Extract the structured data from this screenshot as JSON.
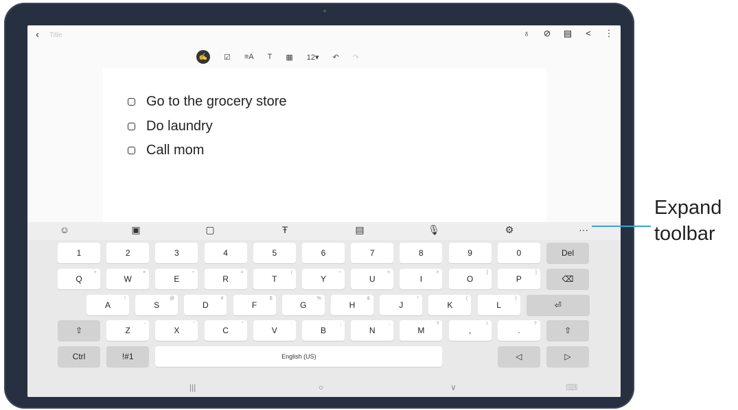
{
  "app": {
    "back_icon": "‹",
    "title_placeholder": "Title"
  },
  "top_icons": [
    {
      "name": "pen-settings-icon",
      "glyph": "♁"
    },
    {
      "name": "attach-icon",
      "glyph": "⊘"
    },
    {
      "name": "reader-icon",
      "glyph": "▤"
    },
    {
      "name": "share-icon",
      "glyph": "<"
    },
    {
      "name": "more-options-icon",
      "glyph": "⋮"
    }
  ],
  "format_toolbar": {
    "pen": "✍",
    "checkbox": "☑",
    "text_style": "≡A",
    "text_format": "T",
    "table": "▦",
    "font_size": "12▾",
    "undo": "↶",
    "redo": "↷"
  },
  "todos": [
    "Go to the grocery store",
    "Do laundry",
    "Call mom"
  ],
  "keyboard_toolbar": [
    {
      "name": "emoji-icon",
      "glyph": "☺"
    },
    {
      "name": "sticker-icon",
      "glyph": "▣"
    },
    {
      "name": "gif-icon",
      "glyph": "▢"
    },
    {
      "name": "handwriting-icon",
      "glyph": "Ŧ"
    },
    {
      "name": "clipboard-icon",
      "glyph": "▤"
    },
    {
      "name": "microphone-icon",
      "glyph": "🎙"
    },
    {
      "name": "settings-icon",
      "glyph": "⚙"
    },
    {
      "name": "expand-toolbar-icon",
      "glyph": "···"
    }
  ],
  "keyboard": {
    "row1": [
      "1",
      "2",
      "3",
      "4",
      "5",
      "6",
      "7",
      "8",
      "9",
      "0"
    ],
    "row1_del": "Del",
    "row2": [
      "Q",
      "W",
      "E",
      "R",
      "T",
      "Y",
      "U",
      "I",
      "O",
      "P"
    ],
    "row2_sub": [
      "+",
      "×",
      "÷",
      "=",
      "/",
      "−",
      "<",
      ">",
      "[",
      "]"
    ],
    "backspace": "⌫",
    "row3": [
      "A",
      "S",
      "D",
      "F",
      "G",
      "H",
      "J",
      "K",
      "L"
    ],
    "row3_sub": [
      "!",
      "@",
      "#",
      "$",
      "%",
      "&",
      "*",
      "(",
      ")"
    ],
    "enter": "⏎",
    "shift": "⇧",
    "row4": [
      "Z",
      "X",
      "C",
      "V",
      "B",
      "N",
      "M"
    ],
    "row4_sub": [
      "-",
      "'",
      "\"",
      ":",
      ";",
      ",",
      "?"
    ],
    "comma_key": ",",
    "comma_sub": "!",
    "period_key": ".",
    "period_sub": "?",
    "ctrl": "Ctrl",
    "symbols": "!#1",
    "space": "English (US)",
    "left_arrow": "◁",
    "right_arrow": "▷"
  },
  "nav": {
    "recents": "|||",
    "home": "○",
    "back": "∨",
    "keyboard": "⌨"
  },
  "callout": {
    "line1": "Expand",
    "line2": "toolbar",
    "color": "#3aa3d6"
  }
}
